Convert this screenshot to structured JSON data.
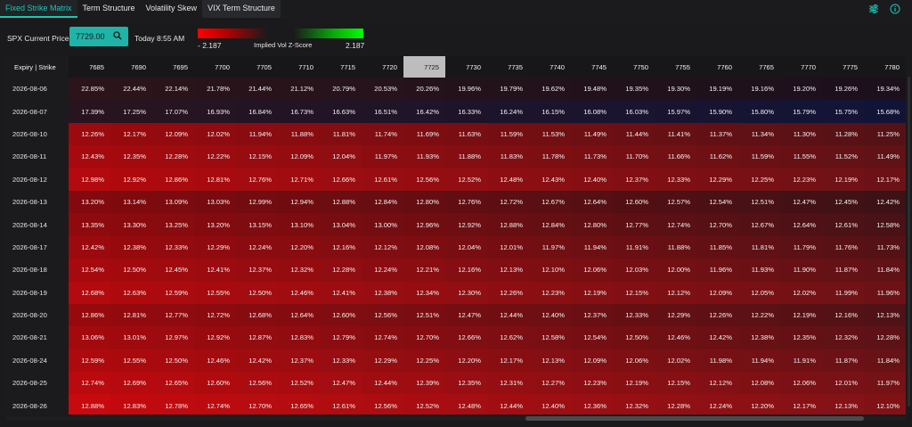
{
  "tabs": [
    {
      "label": "Fixed Strike Matrix",
      "active": true
    },
    {
      "label": "Term Structure",
      "active": false
    },
    {
      "label": "Volatility Skew",
      "active": false
    },
    {
      "label": "VIX Term Structure",
      "active": false
    }
  ],
  "toolbar_icons": [
    "sliders-icon",
    "info-icon"
  ],
  "controls": {
    "spx_label": "SPX Current Price:",
    "spx_value": "7729.00",
    "timestamp": "Today 8:55 AM",
    "zscore_min": "- 2.187",
    "zscore_title": "Implied Vol Z-Score",
    "zscore_max": "2.187"
  },
  "colors": {
    "accent": "#1fb4a7",
    "negative": "#ff0000",
    "positive": "#00ff00"
  },
  "matrix": {
    "corner_label": "Expiry | Strike",
    "highlight_strike": "7725",
    "strikes": [
      "7685",
      "7690",
      "7695",
      "7700",
      "7705",
      "7710",
      "7715",
      "7720",
      "7725",
      "7730",
      "7735",
      "7740",
      "7745",
      "7750",
      "7755",
      "7760",
      "7765",
      "7770",
      "7775",
      "7780"
    ],
    "rows": [
      {
        "expiry": "2026-08-06",
        "values": [
          "22.85%",
          "22.44%",
          "22.14%",
          "21.78%",
          "21.44%",
          "21.12%",
          "20.79%",
          "20.53%",
          "20.26%",
          "19.96%",
          "19.79%",
          "19.62%",
          "19.48%",
          "19.35%",
          "19.30%",
          "19.19%",
          "19.16%",
          "19.20%",
          "19.26%",
          "19.34%"
        ]
      },
      {
        "expiry": "2026-08-07",
        "values": [
          "17.39%",
          "17.25%",
          "17.07%",
          "16.93%",
          "16.84%",
          "16.73%",
          "16.63%",
          "16.51%",
          "16.42%",
          "16.33%",
          "16.24%",
          "16.15%",
          "16.08%",
          "16.03%",
          "15.97%",
          "15.90%",
          "15.80%",
          "15.79%",
          "15.75%",
          "15.68%"
        ]
      },
      {
        "expiry": "2026-08-10",
        "values": [
          "12.26%",
          "12.17%",
          "12.09%",
          "12.02%",
          "11.94%",
          "11.88%",
          "11.81%",
          "11.74%",
          "11.69%",
          "11.63%",
          "11.59%",
          "11.53%",
          "11.49%",
          "11.44%",
          "11.41%",
          "11.37%",
          "11.34%",
          "11.30%",
          "11.28%",
          "11.25%"
        ]
      },
      {
        "expiry": "2026-08-11",
        "values": [
          "12.43%",
          "12.35%",
          "12.28%",
          "12.22%",
          "12.15%",
          "12.09%",
          "12.04%",
          "11.97%",
          "11.93%",
          "11.88%",
          "11.83%",
          "11.78%",
          "11.73%",
          "11.70%",
          "11.66%",
          "11.62%",
          "11.59%",
          "11.55%",
          "11.52%",
          "11.49%"
        ]
      },
      {
        "expiry": "2026-08-12",
        "values": [
          "12.98%",
          "12.92%",
          "12.86%",
          "12.81%",
          "12.76%",
          "12.71%",
          "12.66%",
          "12.61%",
          "12.56%",
          "12.52%",
          "12.48%",
          "12.43%",
          "12.40%",
          "12.37%",
          "12.33%",
          "12.29%",
          "12.25%",
          "12.23%",
          "12.19%",
          "12.17%"
        ]
      },
      {
        "expiry": "2026-08-13",
        "values": [
          "13.20%",
          "13.14%",
          "13.09%",
          "13.03%",
          "12.99%",
          "12.94%",
          "12.88%",
          "12.84%",
          "12.80%",
          "12.76%",
          "12.72%",
          "12.67%",
          "12.64%",
          "12.60%",
          "12.57%",
          "12.54%",
          "12.51%",
          "12.47%",
          "12.45%",
          "12.42%"
        ]
      },
      {
        "expiry": "2026-08-14",
        "values": [
          "13.35%",
          "13.30%",
          "13.25%",
          "13.20%",
          "13.15%",
          "13.10%",
          "13.04%",
          "13.00%",
          "12.96%",
          "12.92%",
          "12.88%",
          "12.84%",
          "12.80%",
          "12.77%",
          "12.74%",
          "12.70%",
          "12.67%",
          "12.64%",
          "12.61%",
          "12.58%"
        ]
      },
      {
        "expiry": "2026-08-17",
        "values": [
          "12.42%",
          "12.38%",
          "12.33%",
          "12.29%",
          "12.24%",
          "12.20%",
          "12.16%",
          "12.12%",
          "12.08%",
          "12.04%",
          "12.01%",
          "11.97%",
          "11.94%",
          "11.91%",
          "11.88%",
          "11.85%",
          "11.81%",
          "11.79%",
          "11.76%",
          "11.73%"
        ]
      },
      {
        "expiry": "2026-08-18",
        "values": [
          "12.54%",
          "12.50%",
          "12.45%",
          "12.41%",
          "12.37%",
          "12.32%",
          "12.28%",
          "12.24%",
          "12.21%",
          "12.16%",
          "12.13%",
          "12.10%",
          "12.06%",
          "12.03%",
          "12.00%",
          "11.96%",
          "11.93%",
          "11.90%",
          "11.87%",
          "11.84%"
        ]
      },
      {
        "expiry": "2026-08-19",
        "values": [
          "12.68%",
          "12.63%",
          "12.59%",
          "12.55%",
          "12.50%",
          "12.46%",
          "12.41%",
          "12.38%",
          "12.34%",
          "12.30%",
          "12.26%",
          "12.23%",
          "12.19%",
          "12.15%",
          "12.12%",
          "12.09%",
          "12.05%",
          "12.02%",
          "11.99%",
          "11.96%"
        ]
      },
      {
        "expiry": "2026-08-20",
        "values": [
          "12.86%",
          "12.81%",
          "12.77%",
          "12.72%",
          "12.68%",
          "12.64%",
          "12.60%",
          "12.56%",
          "12.51%",
          "12.47%",
          "12.44%",
          "12.40%",
          "12.37%",
          "12.33%",
          "12.29%",
          "12.26%",
          "12.22%",
          "12.19%",
          "12.16%",
          "12.13%"
        ]
      },
      {
        "expiry": "2026-08-21",
        "values": [
          "13.06%",
          "13.01%",
          "12.97%",
          "12.92%",
          "12.87%",
          "12.83%",
          "12.79%",
          "12.74%",
          "12.70%",
          "12.66%",
          "12.62%",
          "12.58%",
          "12.54%",
          "12.50%",
          "12.46%",
          "12.42%",
          "12.38%",
          "12.35%",
          "12.32%",
          "12.28%"
        ]
      },
      {
        "expiry": "2026-08-24",
        "values": [
          "12.59%",
          "12.55%",
          "12.50%",
          "12.46%",
          "12.42%",
          "12.37%",
          "12.33%",
          "12.29%",
          "12.25%",
          "12.20%",
          "12.17%",
          "12.13%",
          "12.09%",
          "12.06%",
          "12.02%",
          "11.98%",
          "11.94%",
          "11.91%",
          "11.87%",
          "11.84%"
        ]
      },
      {
        "expiry": "2026-08-25",
        "values": [
          "12.74%",
          "12.69%",
          "12.65%",
          "12.60%",
          "12.56%",
          "12.52%",
          "12.47%",
          "12.44%",
          "12.39%",
          "12.35%",
          "12.31%",
          "12.27%",
          "12.23%",
          "12.19%",
          "12.15%",
          "12.12%",
          "12.08%",
          "12.06%",
          "12.01%",
          "11.97%"
        ]
      },
      {
        "expiry": "2026-08-26",
        "values": [
          "12.88%",
          "12.83%",
          "12.78%",
          "12.74%",
          "12.70%",
          "12.65%",
          "12.61%",
          "12.56%",
          "12.52%",
          "12.48%",
          "12.44%",
          "12.40%",
          "12.36%",
          "12.32%",
          "12.28%",
          "12.24%",
          "12.20%",
          "12.17%",
          "12.13%",
          "12.10%"
        ]
      }
    ]
  }
}
